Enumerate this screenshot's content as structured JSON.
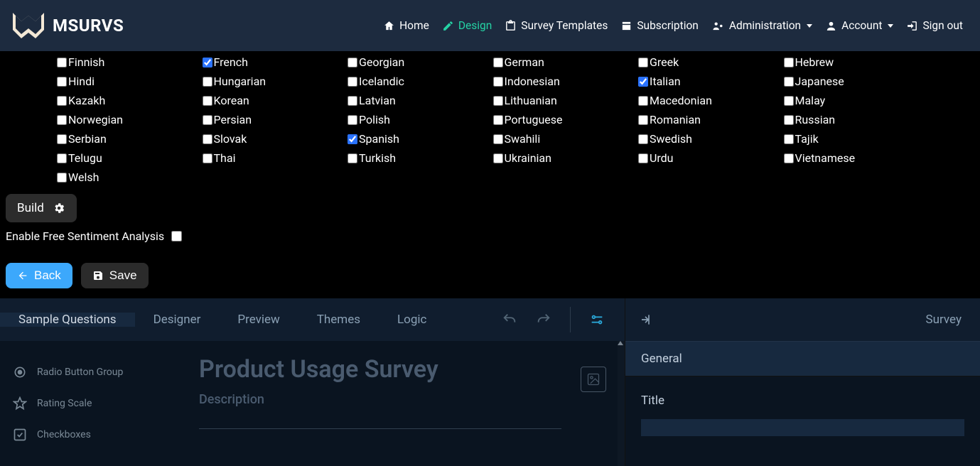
{
  "brand": {
    "name": "MSURVS"
  },
  "nav": {
    "home": "Home",
    "design": "Design",
    "templates": "Survey Templates",
    "subscription": "Subscription",
    "administration": "Administration",
    "account": "Account",
    "signout": "Sign out"
  },
  "languages": [
    {
      "label": "Finnish",
      "checked": false
    },
    {
      "label": "French",
      "checked": true
    },
    {
      "label": "Georgian",
      "checked": false
    },
    {
      "label": "German",
      "checked": false
    },
    {
      "label": "Greek",
      "checked": false
    },
    {
      "label": "Hebrew",
      "checked": false
    },
    {
      "label": "Hindi",
      "checked": false
    },
    {
      "label": "Hungarian",
      "checked": false
    },
    {
      "label": "Icelandic",
      "checked": false
    },
    {
      "label": "Indonesian",
      "checked": false
    },
    {
      "label": "Italian",
      "checked": true
    },
    {
      "label": "Japanese",
      "checked": false
    },
    {
      "label": "Kazakh",
      "checked": false
    },
    {
      "label": "Korean",
      "checked": false
    },
    {
      "label": "Latvian",
      "checked": false
    },
    {
      "label": "Lithuanian",
      "checked": false
    },
    {
      "label": "Macedonian",
      "checked": false
    },
    {
      "label": "Malay",
      "checked": false
    },
    {
      "label": "Norwegian",
      "checked": false
    },
    {
      "label": "Persian",
      "checked": false
    },
    {
      "label": "Polish",
      "checked": false
    },
    {
      "label": "Portuguese",
      "checked": false
    },
    {
      "label": "Romanian",
      "checked": false
    },
    {
      "label": "Russian",
      "checked": false
    },
    {
      "label": "Serbian",
      "checked": false
    },
    {
      "label": "Slovak",
      "checked": false
    },
    {
      "label": "Spanish",
      "checked": true
    },
    {
      "label": "Swahili",
      "checked": false
    },
    {
      "label": "Swedish",
      "checked": false
    },
    {
      "label": "Tajik",
      "checked": false
    },
    {
      "label": "Telugu",
      "checked": false
    },
    {
      "label": "Thai",
      "checked": false
    },
    {
      "label": "Turkish",
      "checked": false
    },
    {
      "label": "Ukrainian",
      "checked": false
    },
    {
      "label": "Urdu",
      "checked": false
    },
    {
      "label": "Vietnamese",
      "checked": false
    },
    {
      "label": "Welsh",
      "checked": false
    }
  ],
  "buildPill": {
    "label": "Build"
  },
  "sentiment": {
    "label": "Enable Free Sentiment Analysis",
    "checked": false
  },
  "buttons": {
    "back": "Back",
    "save": "Save"
  },
  "designerTabs": {
    "sample": "Sample Questions",
    "designer": "Designer",
    "preview": "Preview",
    "themes": "Themes",
    "logic": "Logic"
  },
  "toolbox": {
    "radio": "Radio Button Group",
    "rating": "Rating Scale",
    "checkboxes": "Checkboxes"
  },
  "surveyForm": {
    "title": "Product Usage Survey",
    "description": "Description"
  },
  "rightPanel": {
    "headerLabel": "Survey",
    "sectionGeneral": "General",
    "fieldTitle": "Title"
  }
}
